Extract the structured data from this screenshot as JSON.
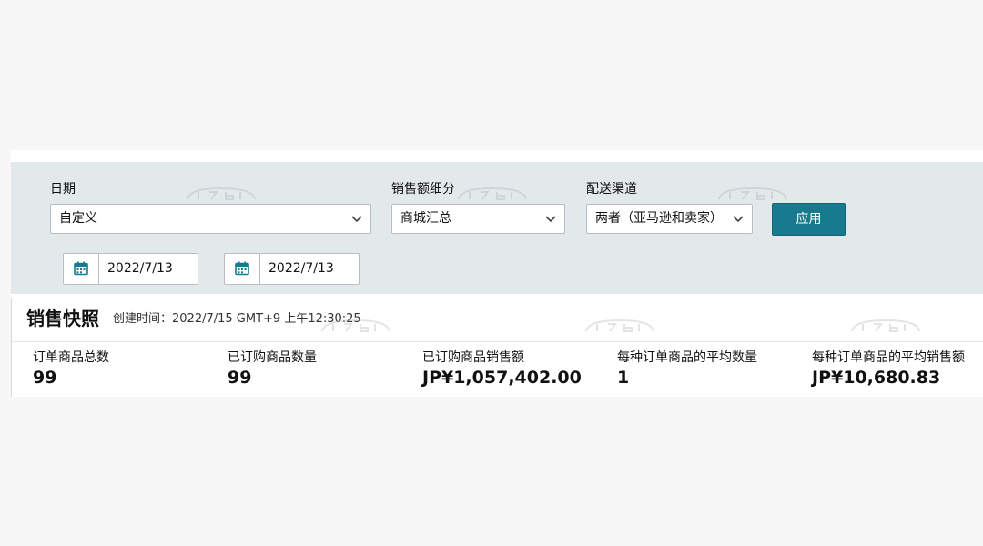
{
  "filters": {
    "date": {
      "label": "日期",
      "selected": "自定义",
      "start_date": "2022/7/13",
      "end_date": "2022/7/13"
    },
    "sales_breakdown": {
      "label": "销售额细分",
      "selected": "商城汇总"
    },
    "fulfillment_channel": {
      "label": "配送渠道",
      "selected": "两者（亚马逊和卖家）"
    },
    "apply_label": "应用"
  },
  "snapshot": {
    "title": "销售快照",
    "created_time": "创建时间：2022/7/15 GMT+9 上午12:30:25",
    "metrics": [
      {
        "label": "订单商品总数",
        "value": "99"
      },
      {
        "label": "已订购商品数量",
        "value": "99"
      },
      {
        "label": "已订购商品销售额",
        "value": "JP¥1,057,402.00"
      },
      {
        "label": "每种订单商品的平均数量",
        "value": "1"
      },
      {
        "label": "每种订单商品的平均销售额",
        "value": "JP¥10,680.83"
      }
    ]
  },
  "icons": {
    "chevron": "chevron-down-icon",
    "calendar": "calendar-icon"
  },
  "colors": {
    "accent": "#187a8e",
    "filter_panel_background": "#e3e8eb",
    "page_background": "#f7f7f7"
  }
}
